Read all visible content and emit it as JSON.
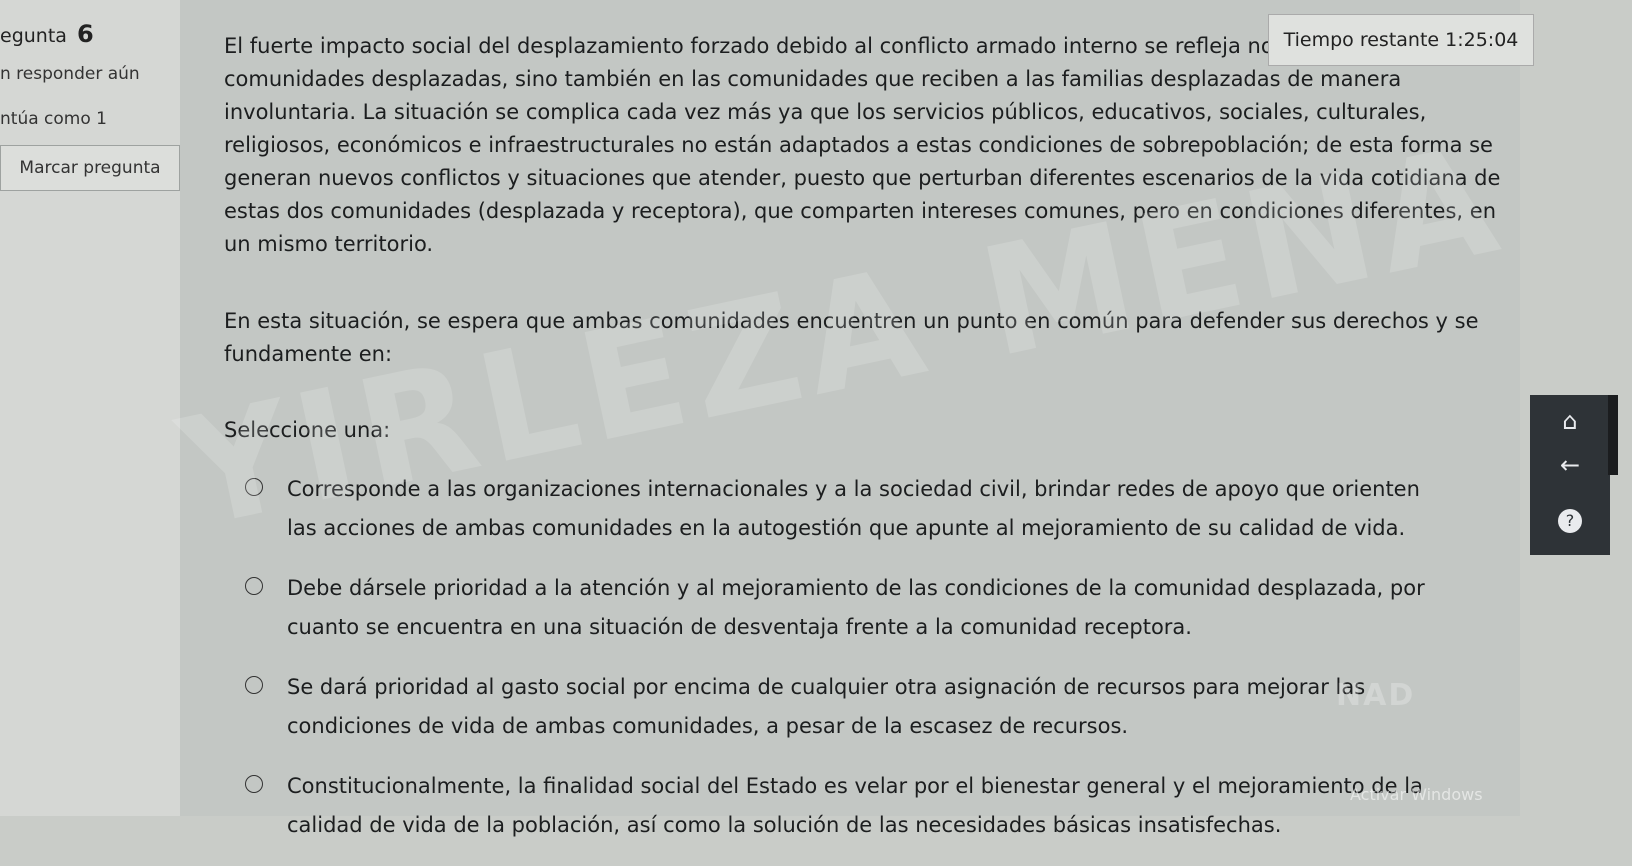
{
  "sidebar": {
    "question_label": "egunta",
    "question_number": "6",
    "status": "n responder aún",
    "score": "ntúa como 1",
    "flag_label": "Marcar pregunta"
  },
  "timer": {
    "label": "Tiempo restante",
    "value": "1:25:04"
  },
  "question": {
    "paragraph": "El fuerte impacto social del desplazamiento forzado debido al conflicto armado interno se refleja no solo en las comunidades desplazadas, sino también en las comunidades que reciben a las familias desplazadas de manera involuntaria. La situación se complica cada vez más ya que los servicios públicos, educativos, sociales, culturales, religiosos, económicos e infraestructurales no están adaptados a estas condiciones de sobrepoblación; de esta forma se generan nuevos conflictos y situaciones que atender, puesto que perturban diferentes escenarios de la vida cotidiana de estas dos comunidades (desplazada y receptora), que comparten intereses comunes, pero en condiciones diferentes, en un mismo territorio.",
    "prompt": "En esta situación, se espera que ambas comunidades encuentren un punto en común para defender sus derechos y se fundamente en:",
    "select_label": "Seleccione una:"
  },
  "options": [
    {
      "text": "Corresponde a las organizaciones internacionales y a la sociedad civil, brindar redes de apoyo que orienten las acciones de ambas comunidades en la autogestión que apunte al mejoramiento de su calidad de vida."
    },
    {
      "text": "Debe dársele prioridad a la atención y al mejoramiento de las condiciones de la comunidad desplazada, por cuanto se encuentra en una situación de desventaja frente a la comunidad receptora."
    },
    {
      "text": "Se dará prioridad al gasto social por encima de cualquier otra asignación de recursos para mejorar las condiciones de vida de ambas comunidades, a pesar de la escasez de recursos."
    },
    {
      "text": "Constitucionalmente, la finalidad social del Estado es velar por el bienestar general y el mejoramiento de la calidad de vida de la población, así como la solución de las necesidades básicas insatisfechas."
    }
  ],
  "watermark": "YIRLEZA MENA",
  "overlay": {
    "nad": "NAD",
    "activate": "Activar Windows"
  },
  "icons": {
    "home": "home-icon",
    "back": "arrow-left-icon",
    "help": "help-icon"
  }
}
